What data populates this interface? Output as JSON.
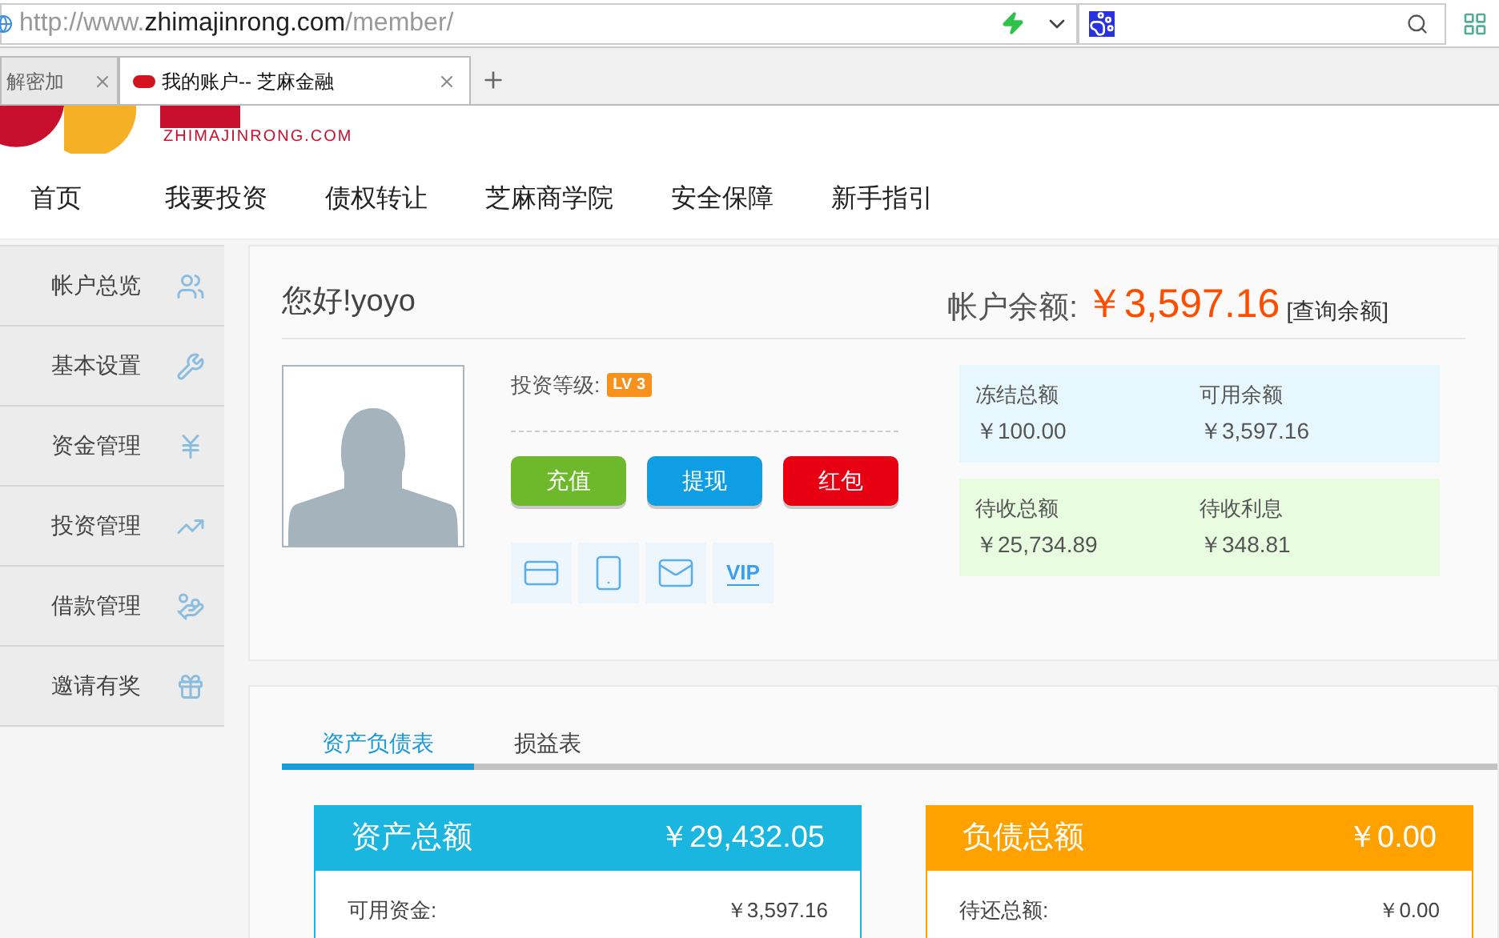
{
  "browser": {
    "url_host": "http://www.zhimajinrong.com",
    "url_path": "/member/",
    "tabs": [
      {
        "title": "解密加",
        "selected": false
      },
      {
        "title": "我的账户-- 芝麻金融",
        "selected": true
      }
    ]
  },
  "logo": {
    "subtext": "ZHIMAJINRONG.COM"
  },
  "nav": [
    "首页",
    "我要投资",
    "债权转让",
    "芝麻商学院",
    "安全保障",
    "新手指引"
  ],
  "sidebar": {
    "items": [
      {
        "label": "帐户总览"
      },
      {
        "label": "基本设置"
      },
      {
        "label": "资金管理"
      },
      {
        "label": "投资管理"
      },
      {
        "label": "借款管理"
      },
      {
        "label": "邀请有奖"
      }
    ]
  },
  "profile": {
    "greeting": "您好!yoyo",
    "level_label": "投资等级:",
    "level_badge": "LV 3",
    "buttons": [
      {
        "label": "充值",
        "color": "#6eb92b"
      },
      {
        "label": "提现",
        "color": "#0f9de3"
      },
      {
        "label": "红包",
        "color": "#e60012"
      }
    ],
    "vip_label": "VIP"
  },
  "balance": {
    "label": "帐户余额:",
    "amount": "￥3,597.16",
    "link": "[查询余额]"
  },
  "summary": [
    {
      "color": "#e6f7fe",
      "items": [
        {
          "label": "冻结总额",
          "value": "￥100.00"
        },
        {
          "label": "可用余额",
          "value": "￥3,597.16"
        }
      ]
    },
    {
      "color": "#e8fde0",
      "items": [
        {
          "label": "待收总额",
          "value": "￥25,734.89"
        },
        {
          "label": "待收利息",
          "value": "￥348.81"
        }
      ]
    }
  ],
  "report_tabs": [
    {
      "label": "资产负债表",
      "selected": true
    },
    {
      "label": "损益表",
      "selected": false
    }
  ],
  "panels": [
    {
      "title": "资产总额",
      "total": "￥29,432.05",
      "color": "#1bb6e0",
      "rows": [
        {
          "label": "可用资金:",
          "value": "￥3,597.16"
        }
      ]
    },
    {
      "title": "负债总额",
      "total": "￥0.00",
      "color": "#ffa200",
      "rows": [
        {
          "label": "待还总额:",
          "value": "￥0.00"
        }
      ]
    }
  ]
}
